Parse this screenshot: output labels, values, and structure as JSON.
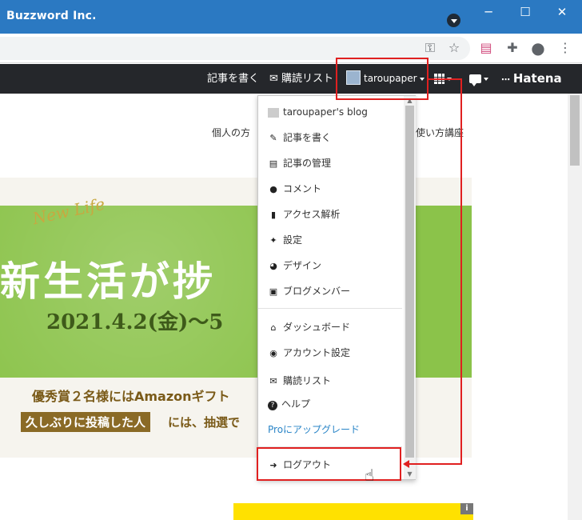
{
  "window": {
    "title": "Buzzword Inc.",
    "minimize": "─",
    "maximize": "☐",
    "close": "✕"
  },
  "toolbar": {
    "key_icon": "⚿",
    "star_icon": "☆",
    "ext1_icon": "▤",
    "puzzle_icon": "✚",
    "account_icon": "●",
    "more_icon": "⋮"
  },
  "header": {
    "write_article": "記事を書く",
    "subscriptions": "購読リスト",
    "username": "taroupaper",
    "logo": "Hatena"
  },
  "page": {
    "nav_left": "個人の方",
    "nav_right": "使い方講座",
    "banner": {
      "script": "New Life",
      "title": "新生活が捗",
      "date": "2021.4.2(金)〜5",
      "prize": "優秀賞２名様にはAmazonギフト",
      "lottery_label": "久しぶりに投稿した人",
      "lottery_text": "には、抽選で"
    },
    "ad_info": "i"
  },
  "menu": {
    "blog_name": "taroupaper's blog",
    "items_top": [
      {
        "label": "記事を書く",
        "icon": "✎"
      },
      {
        "label": "記事の管理",
        "icon": "▤"
      },
      {
        "label": "コメント",
        "icon": "●"
      },
      {
        "label": "アクセス解析",
        "icon": "▮"
      },
      {
        "label": "設定",
        "icon": "✦"
      },
      {
        "label": "デザイン",
        "icon": "◕"
      },
      {
        "label": "ブログメンバー",
        "icon": "▣"
      }
    ],
    "items_bottom": [
      {
        "label": "ダッシュボード",
        "icon": "⌂"
      },
      {
        "label": "アカウント設定",
        "icon": "◉"
      },
      {
        "label": "購読リスト",
        "icon": "✉"
      },
      {
        "label": "ヘルプ",
        "icon": "?"
      }
    ],
    "pro_upgrade": "Proにアップグレード",
    "logout": "ログアウト",
    "logout_icon": "➜"
  },
  "colors": {
    "annotation": "#e02020",
    "titlebar": "#2B79C2",
    "header": "#25272b"
  }
}
